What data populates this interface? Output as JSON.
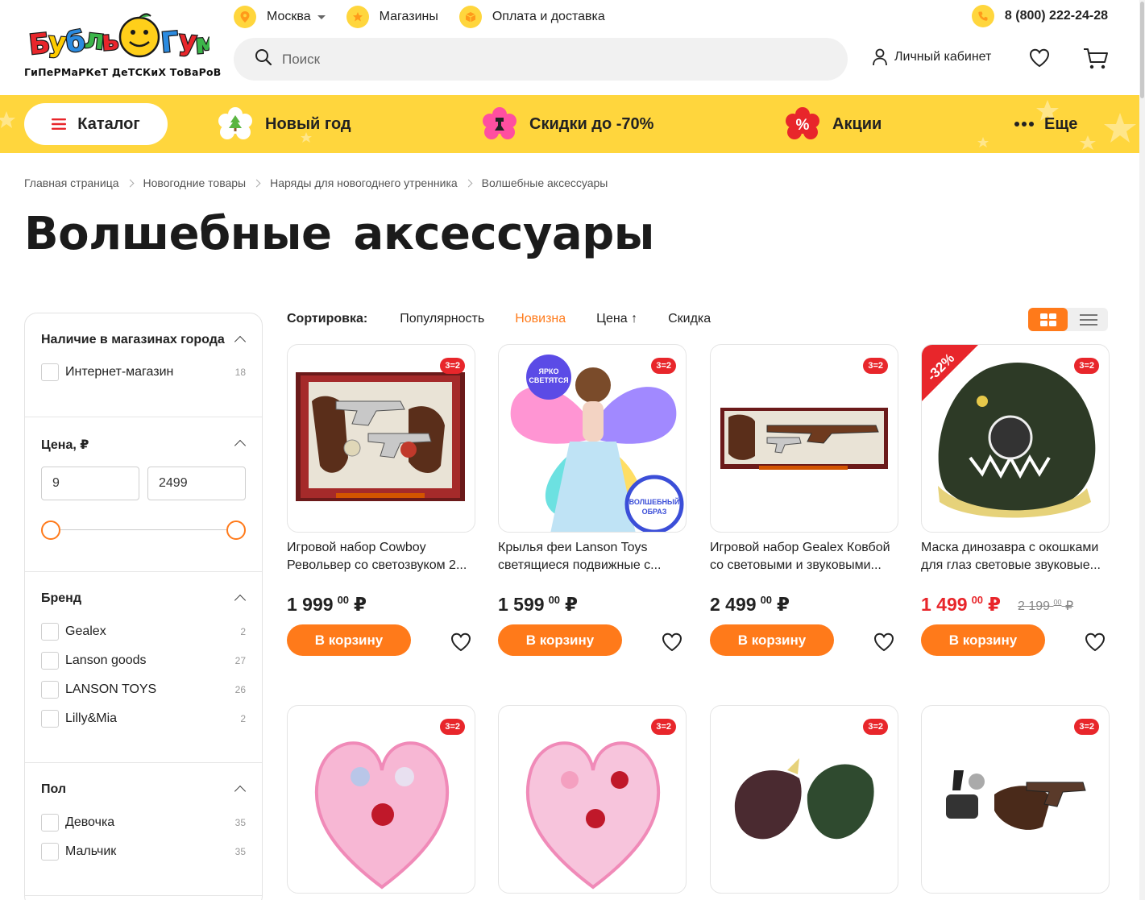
{
  "logo": {
    "brand": "Бубль Гум",
    "tagline": "ГиПеРМаРКеТ ДеТСКиХ ТоВаРоВ"
  },
  "toplinks": {
    "city": "Москва",
    "stores": "Магазины",
    "delivery": "Оплата и доставка",
    "phone": "8 (800) 222-24-28"
  },
  "search": {
    "placeholder": "Поиск"
  },
  "account": {
    "label": "Личный кабинет"
  },
  "nav": {
    "catalog": "Каталог",
    "new_year": "Новый год",
    "sale": "Скидки до -70%",
    "promo": "Акции",
    "more": "Еще",
    "promo_icon_text": "%"
  },
  "breadcrumbs": [
    "Главная страница",
    "Новогодние товары",
    "Наряды для новогоднего утренника",
    "Волшебные аксессуары"
  ],
  "page_title": "Волшебные аксессуары",
  "filters": {
    "availability": {
      "title": "Наличие в магазинах города",
      "options": [
        {
          "label": "Интернет-магазин",
          "count": "18"
        }
      ]
    },
    "price": {
      "title": "Цена, ₽",
      "min": "9",
      "max": "2499"
    },
    "brand": {
      "title": "Бренд",
      "options": [
        {
          "label": "Gealex",
          "count": "2"
        },
        {
          "label": "Lanson goods",
          "count": "27"
        },
        {
          "label": "LANSON TOYS",
          "count": "26"
        },
        {
          "label": "Lilly&Mia",
          "count": "2"
        }
      ]
    },
    "gender": {
      "title": "Пол",
      "options": [
        {
          "label": "Девочка",
          "count": "35"
        },
        {
          "label": "Мальчик",
          "count": "35"
        }
      ]
    }
  },
  "sort": {
    "label": "Сортировка:",
    "options": [
      "Популярность",
      "Новизна",
      "Цена",
      "Скидка"
    ],
    "active": "Новизна"
  },
  "products": [
    {
      "name1": "Игровой набор Cowboy",
      "name2": "Револьвер со светозвуком 2...",
      "price_rub": "1 999",
      "price_kop": "00",
      "currency": "₽",
      "badge": "3=2",
      "buy": "В корзину"
    },
    {
      "name1": "Крылья феи Lanson Toys",
      "name2": "светящиеся подвижные с...",
      "price_rub": "1 599",
      "price_kop": "00",
      "currency": "₽",
      "badge": "3=2",
      "buy": "В корзину",
      "img_text1": "ЯРКО СВЕТЯТСЯ",
      "img_text2": "ВОЛШЕБНЫЙ ОБРАЗ"
    },
    {
      "name1": "Игровой набор Gealex Ковбой",
      "name2": "со световыми и звуковыми...",
      "price_rub": "2 499",
      "price_kop": "00",
      "currency": "₽",
      "badge": "3=2",
      "buy": "В корзину"
    },
    {
      "name1": "Маска динозавра с окошками",
      "name2": "для глаз световые звуковые...",
      "price_rub": "1 499",
      "price_kop": "00",
      "currency": "₽",
      "old_rub": "2 199",
      "old_kop": "00",
      "badge": "3=2",
      "discount": "-32%",
      "buy": "В корзину"
    },
    {
      "badge": "3=2"
    },
    {
      "badge": "3=2"
    },
    {
      "badge": "3=2"
    },
    {
      "badge": "3=2"
    }
  ],
  "colors": {
    "accent": "#ff7a1a",
    "nav_yellow": "#ffd63d",
    "sale_red": "#e8262b"
  }
}
